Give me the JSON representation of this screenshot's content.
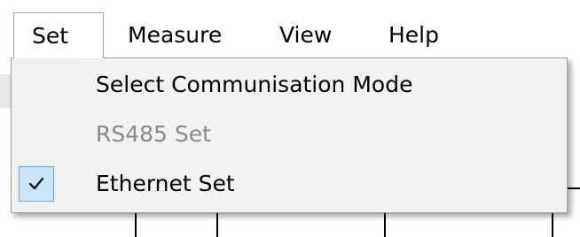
{
  "menubar": {
    "items": [
      {
        "label": "Set"
      },
      {
        "label": "Measure"
      },
      {
        "label": "View"
      },
      {
        "label": "Help"
      }
    ]
  },
  "set_menu": {
    "items": [
      {
        "label": "Select Communisation Mode",
        "enabled": true,
        "checked": false
      },
      {
        "label": "RS485 Set",
        "enabled": false,
        "checked": false
      },
      {
        "label": "Ethernet Set",
        "enabled": true,
        "checked": true
      }
    ],
    "check_icon": "checkmark-icon"
  },
  "colors": {
    "menu_background": "#f2f2f2",
    "disabled_text": "#8a8a8a",
    "check_highlight": "#cce4f7",
    "check_border": "#6aa8dd"
  }
}
